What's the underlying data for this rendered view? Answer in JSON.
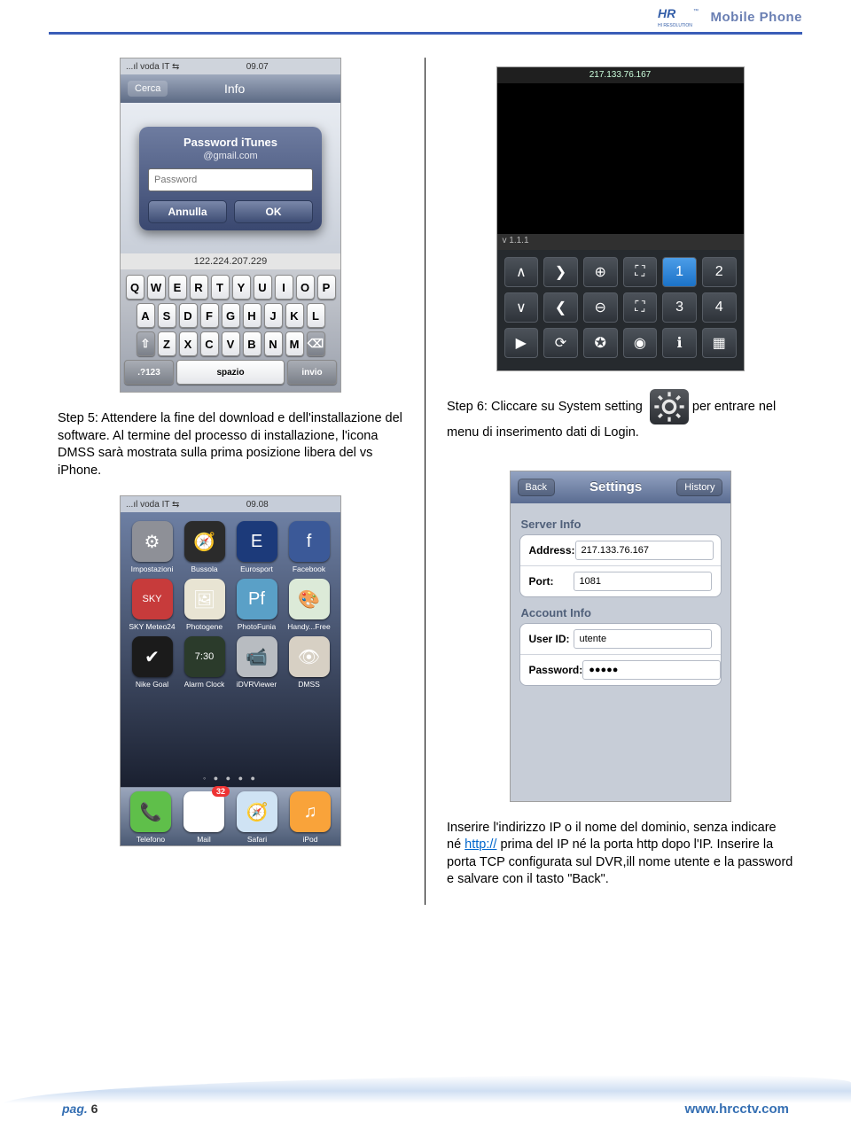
{
  "header": {
    "title": "Mobile Phone",
    "logo_main": "HR",
    "logo_sub": "HI RESOLUTION"
  },
  "left": {
    "step5_text": "Step 5: Attendere la fine del download e dell'installazione del software. Al termine del processo di installazione, l'icona  DMSS sarà mostrata sulla prima posizione libera del vs iPhone.",
    "screenA": {
      "carrier": "...ıl voda IT  ⇆",
      "time": "09.07",
      "nav_back": "Cerca",
      "nav_title": "Info",
      "popup_title": "Password iTunes",
      "popup_email": "@gmail.com",
      "popup_placeholder": "Password",
      "btn_cancel": "Annulla",
      "btn_ok": "OK",
      "small_ip": "122.224.207.229",
      "rows": {
        "r1": [
          "Q",
          "W",
          "E",
          "R",
          "T",
          "Y",
          "U",
          "I",
          "O",
          "P"
        ],
        "r2": [
          "A",
          "S",
          "D",
          "F",
          "G",
          "H",
          "J",
          "K",
          "L"
        ],
        "r3": [
          "Z",
          "X",
          "C",
          "V",
          "B",
          "N",
          "M"
        ],
        "mod": ".?123",
        "space": "spazio",
        "enter": "invio",
        "shift": "⇧",
        "back": "⌫"
      }
    },
    "screenB": {
      "carrier": "...ıl voda IT  ⇆",
      "time": "09.08",
      "apps_r1": [
        {
          "label": "Impostazioni",
          "bg": "#8e9097",
          "glyph": "⚙"
        },
        {
          "label": "Bussola",
          "bg": "#2b2b2b",
          "glyph": "🧭"
        },
        {
          "label": "Eurosport",
          "bg": "#1c3a7a",
          "glyph": "E"
        },
        {
          "label": "Facebook",
          "bg": "#3b5998",
          "glyph": "f"
        }
      ],
      "apps_r2": [
        {
          "label": "SKY Meteo24",
          "bg": "#c73b3b",
          "glyph": "SKY"
        },
        {
          "label": "Photogene",
          "bg": "#e8e4d3",
          "glyph": "🖼"
        },
        {
          "label": "PhotoFunia",
          "bg": "#5aa0c7",
          "glyph": "Pf"
        },
        {
          "label": "Handy...Free",
          "bg": "#dcead8",
          "glyph": "🎨"
        }
      ],
      "apps_r3": [
        {
          "label": "Nike Goal",
          "bg": "#1b1b1b",
          "glyph": "✔"
        },
        {
          "label": "Alarm Clock",
          "bg": "#2b3b2b",
          "glyph": "7:30"
        },
        {
          "label": "iDVRViewer",
          "bg": "#b8bcc1",
          "glyph": "📹"
        },
        {
          "label": "DMSS",
          "bg": "#d7d0c4",
          "glyph": "👁"
        }
      ],
      "dock": [
        {
          "label": "Telefono",
          "bg": "#5fbf4a",
          "glyph": "📞"
        },
        {
          "label": "Mail",
          "bg": "#ffffff",
          "glyph": "✉",
          "badge": "32"
        },
        {
          "label": "Safari",
          "bg": "#cfe3f4",
          "glyph": "🧭"
        },
        {
          "label": "iPod",
          "bg": "#f9a33a",
          "glyph": "♫"
        }
      ]
    }
  },
  "right": {
    "screenC": {
      "ip": "217.133.76.167",
      "ver": "v 1.1.1",
      "row1": [
        "∧",
        "❯",
        "⊕",
        "⛶",
        "1",
        "2"
      ],
      "row2": [
        "∨",
        "❮",
        "⊖",
        "⛶",
        "3",
        "4"
      ],
      "row3": [
        "▶",
        "⟳",
        "✪",
        "◉",
        "ℹ",
        "▦"
      ],
      "selected_index": 4
    },
    "step6_pre": "Step 6: Cliccare su System setting",
    "step6_post": " per entrare nel menu di inserimento dati di Login.",
    "screenD": {
      "back": "Back",
      "title": "Settings",
      "history": "History",
      "sect1": "Server Info",
      "address_label": "Address:",
      "address_val": "217.133.76.167",
      "port_label": "Port:",
      "port_val": "1081",
      "sect2": "Account Info",
      "userid_label": "User ID:",
      "userid_val": "utente",
      "password_label": "Password:",
      "password_val": "●●●●●"
    },
    "para2_a": "Inserire l'indirizzo IP o il nome del dominio, senza indicare né  ",
    "para2_link": "http://",
    "para2_b": "  prima del IP né la porta http dopo l'IP. Inserire la porta TCP configurata sul DVR,ill nome utente e la password e salvare con il tasto \"Back\"."
  },
  "footer": {
    "pag_label": "pag.",
    "pag_num": "6",
    "site": "www.hrcctv.com"
  }
}
